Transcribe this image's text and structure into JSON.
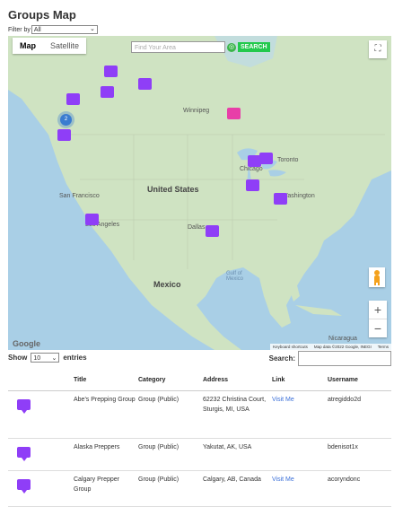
{
  "page": {
    "title": "Groups Map"
  },
  "filter": {
    "label": "Filter by",
    "selected": "All"
  },
  "map": {
    "tabs": [
      {
        "label": "Map",
        "active": true
      },
      {
        "label": "Satellite",
        "active": false
      }
    ],
    "search_placeholder": "Find Your Area",
    "search_button": "SEARCH",
    "zoom_in": "+",
    "zoom_out": "−",
    "google": "Google",
    "attribution": {
      "shortcuts": "Keyboard shortcuts",
      "data": "Map data ©2022 Google, INEGI",
      "terms": "Terms"
    },
    "labels": {
      "winnipeg": "Winnipeg",
      "united_states": "United States",
      "san_francisco": "San Francisco",
      "los_angeles": "Los Angeles",
      "dallas": "Dallas",
      "chicago": "Chicago",
      "toronto": "Toronto",
      "washington": "Washington",
      "mexico": "Mexico",
      "gulf": "Gulf of Mexico",
      "nicaragua": "Nicaragua"
    },
    "cluster_count": "2",
    "colors": {
      "pin": "#8f3ef7",
      "highlight_pin": "#e83ea8",
      "water": "#a9cfe6",
      "land": "#cfe3c2",
      "search_button": "#23c94d"
    }
  },
  "table": {
    "show_label": "Show",
    "entries_value": "10",
    "entries_label": "entries",
    "search_label": "Search:",
    "columns": [
      "Title",
      "Category",
      "Address",
      "Link",
      "Username"
    ],
    "rows": [
      {
        "title": "Abe's Prepping Group",
        "category": "Group (Public)",
        "address": "62232 Christina Court, Sturgis, MI, USA",
        "link": "Visit Me",
        "username": "atregiddo2d"
      },
      {
        "title": "Alaska Preppers",
        "category": "Group (Public)",
        "address": "Yakutat, AK, USA",
        "link": "",
        "username": "bdenisot1x"
      },
      {
        "title": "Calgary Prepper Group",
        "category": "Group (Public)",
        "address": "Calgary, AB, Canada",
        "link": "Visit Me",
        "username": "acoryndonc"
      }
    ]
  }
}
